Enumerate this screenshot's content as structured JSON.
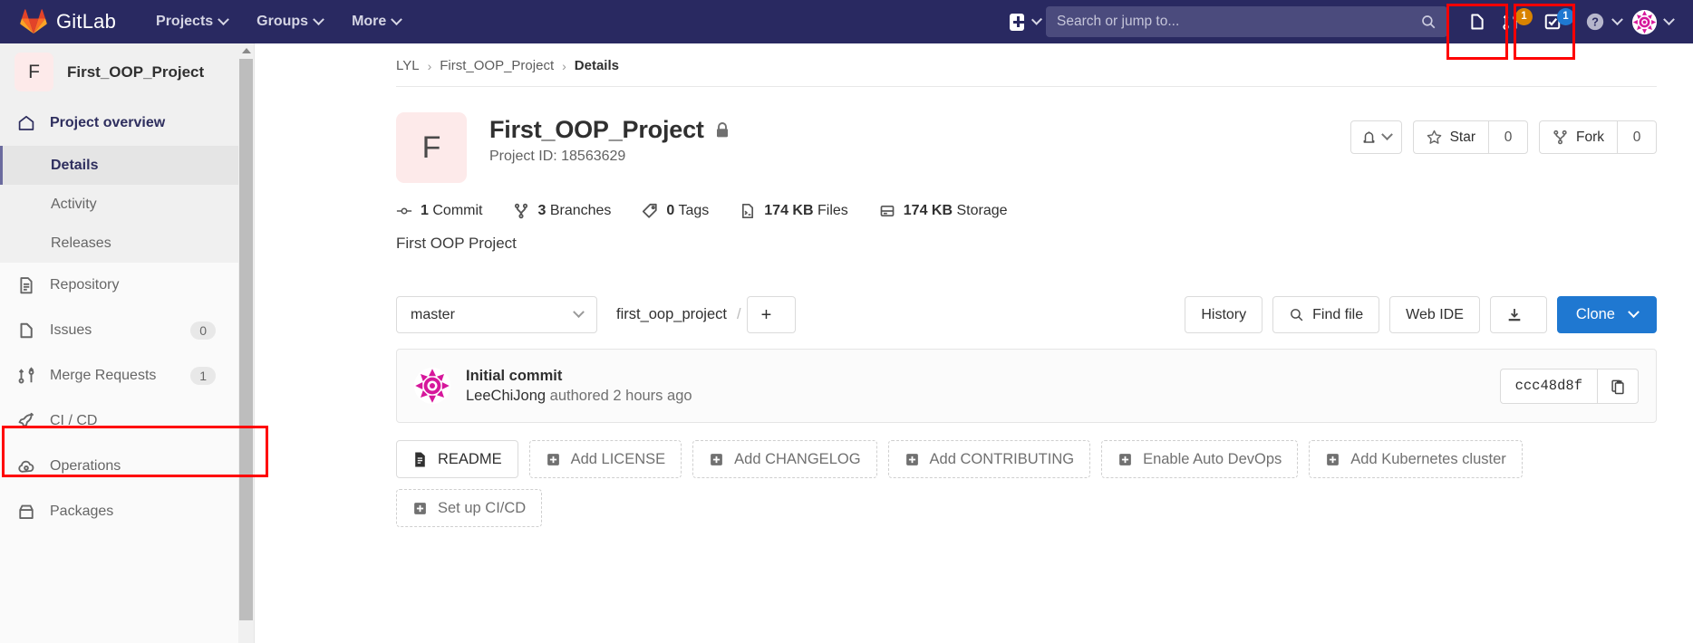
{
  "navbar": {
    "brand": "GitLab",
    "logo_icon": "gitlab-tanuki-logo",
    "links": [
      {
        "label": "Projects",
        "icon": "chevron-down-icon"
      },
      {
        "label": "Groups",
        "icon": "chevron-down-icon"
      },
      {
        "label": "More",
        "icon": "chevron-down-icon"
      }
    ],
    "create_new_icon": "plus-square-icon",
    "search": {
      "placeholder": "Search or jump to...",
      "value": "",
      "icon": "search-icon"
    },
    "issues_icon": "issues-icon",
    "merge_requests": {
      "icon": "merge-request-icon",
      "count": "1",
      "badge_color": "#d98300"
    },
    "todos": {
      "icon": "todo-check-icon",
      "count": "1",
      "badge_color": "#1f78d1"
    },
    "help_icon": "question-circle-icon",
    "user_avatar_icon": "user-avatar"
  },
  "sidebar": {
    "project_initial": "F",
    "project_name": "First_OOP_Project",
    "items": [
      {
        "label": "Project overview",
        "icon": "home-icon",
        "count": ""
      },
      {
        "label": "Details",
        "icon": "",
        "count": "",
        "sub": true,
        "current": true
      },
      {
        "label": "Activity",
        "icon": "",
        "count": "",
        "sub": true
      },
      {
        "label": "Releases",
        "icon": "",
        "count": "",
        "sub": true
      },
      {
        "label": "Repository",
        "icon": "document-icon",
        "count": ""
      },
      {
        "label": "Issues",
        "icon": "issues-icon",
        "count": "0"
      },
      {
        "label": "Merge Requests",
        "icon": "merge-request-icon",
        "count": "1",
        "highlighted": true
      },
      {
        "label": "CI / CD",
        "icon": "rocket-icon",
        "count": ""
      },
      {
        "label": "Operations",
        "icon": "cloud-gear-icon",
        "count": ""
      },
      {
        "label": "Packages",
        "icon": "package-icon",
        "count": ""
      }
    ]
  },
  "breadcrumb": {
    "items": [
      "LYL",
      "First_OOP_Project",
      "Details"
    ],
    "separator": "›"
  },
  "project": {
    "initial": "F",
    "name": "First_OOP_Project",
    "visibility_icon": "lock-icon",
    "id_label": "Project ID: 18563629",
    "description": "First OOP Project",
    "notifications_icon": "bell-icon",
    "star": {
      "label": "Star",
      "icon": "star-icon",
      "count": "0"
    },
    "fork": {
      "label": "Fork",
      "icon": "fork-icon",
      "count": "0"
    },
    "stats": [
      {
        "icon": "commit-icon",
        "value": "1",
        "label": "Commit"
      },
      {
        "icon": "branch-icon",
        "value": "3",
        "label": "Branches"
      },
      {
        "icon": "tag-icon",
        "value": "0",
        "label": "Tags"
      },
      {
        "icon": "file-icon",
        "value": "174 KB",
        "label": "Files"
      },
      {
        "icon": "storage-icon",
        "value": "174 KB",
        "label": "Storage"
      }
    ]
  },
  "repo_bar": {
    "branch": "master",
    "path_root": "first_oop_project",
    "path_separator": "/",
    "add_icon": "plus-icon",
    "history_label": "History",
    "find_file_label": "Find file",
    "find_file_icon": "search-icon",
    "web_ide_label": "Web IDE",
    "download_icon": "download-icon",
    "clone_label": "Clone"
  },
  "last_commit": {
    "avatar_icon": "user-avatar",
    "title": "Initial commit",
    "author": "LeeChiJong",
    "meta": "authored 2 hours ago",
    "sha": "ccc48d8f",
    "copy_icon": "clipboard-icon"
  },
  "quick_actions": [
    {
      "label": "README",
      "icon": "readme-file-icon",
      "style": "solid"
    },
    {
      "label": "Add LICENSE",
      "icon": "plus-square-icon",
      "style": "dashed"
    },
    {
      "label": "Add CHANGELOG",
      "icon": "plus-square-icon",
      "style": "dashed"
    },
    {
      "label": "Add CONTRIBUTING",
      "icon": "plus-square-icon",
      "style": "dashed"
    },
    {
      "label": "Enable Auto DevOps",
      "icon": "plus-square-icon",
      "style": "dashed"
    },
    {
      "label": "Add Kubernetes cluster",
      "icon": "plus-square-icon",
      "style": "dashed"
    },
    {
      "label": "Set up CI/CD",
      "icon": "plus-square-icon",
      "style": "dashed"
    }
  ],
  "colors": {
    "navbar_bg": "#292961",
    "primary": "#1f78d1",
    "annotation": "#ff0000",
    "badge_orange": "#d98300",
    "badge_blue": "#1f78d1"
  }
}
